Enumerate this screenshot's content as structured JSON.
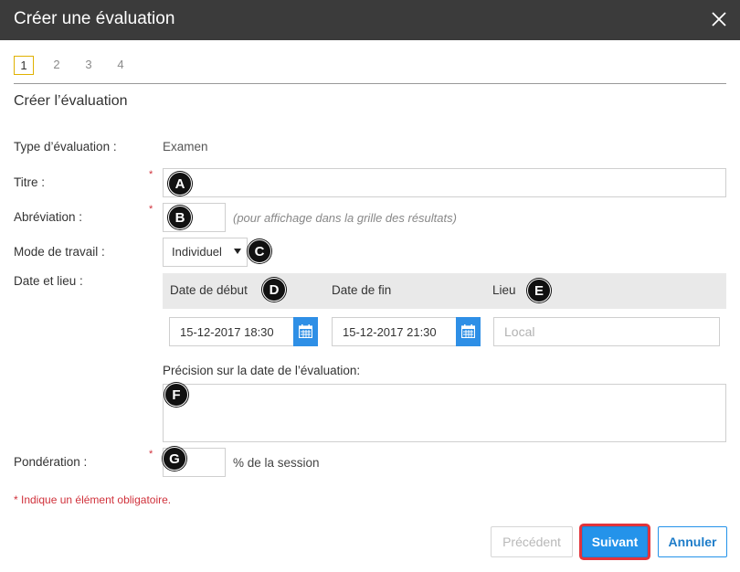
{
  "window": {
    "title": "Créer une évaluation",
    "close_icon": "close-icon"
  },
  "steps": [
    "1",
    "2",
    "3",
    "4"
  ],
  "active_step": "1",
  "section_title": "Créer l’évaluation",
  "required_mark": "*",
  "form": {
    "type": {
      "label": "Type d’évaluation :",
      "value": "Examen"
    },
    "titre": {
      "label": "Titre :",
      "value": "",
      "callout": "A"
    },
    "abreviation": {
      "label": "Abréviation :",
      "value": "",
      "hint": "(pour affichage dans la grille des résultats)",
      "callout": "B"
    },
    "mode": {
      "label": "Mode de travail :",
      "selected": "Individuel",
      "callout": "C"
    },
    "date_lieu": {
      "label": "Date et lieu :",
      "start_header": "Date de début",
      "end_header": "Date de fin",
      "place_header": "Lieu",
      "start_value": "15-12-2017 18:30",
      "end_value": "15-12-2017 21:30",
      "place_placeholder": "Local",
      "callout_start": "D",
      "callout_place": "E",
      "calendar_icon": "calendar-icon"
    },
    "precision": {
      "label": "Précision sur la date de l’évaluation:",
      "value": "",
      "callout": "F"
    },
    "ponderation": {
      "label": "Pondération :",
      "value": "",
      "suffix": "% de la session",
      "callout": "G"
    }
  },
  "required_note": "* Indique un élément obligatoire.",
  "buttons": {
    "previous": "Précédent",
    "next": "Suivant",
    "cancel": "Annuler"
  },
  "colors": {
    "titlebar": "#3b3b3b",
    "accent": "#2493ea",
    "required": "#d0313b",
    "highlight": "#e2343b",
    "active_step_border": "#e0b100"
  }
}
